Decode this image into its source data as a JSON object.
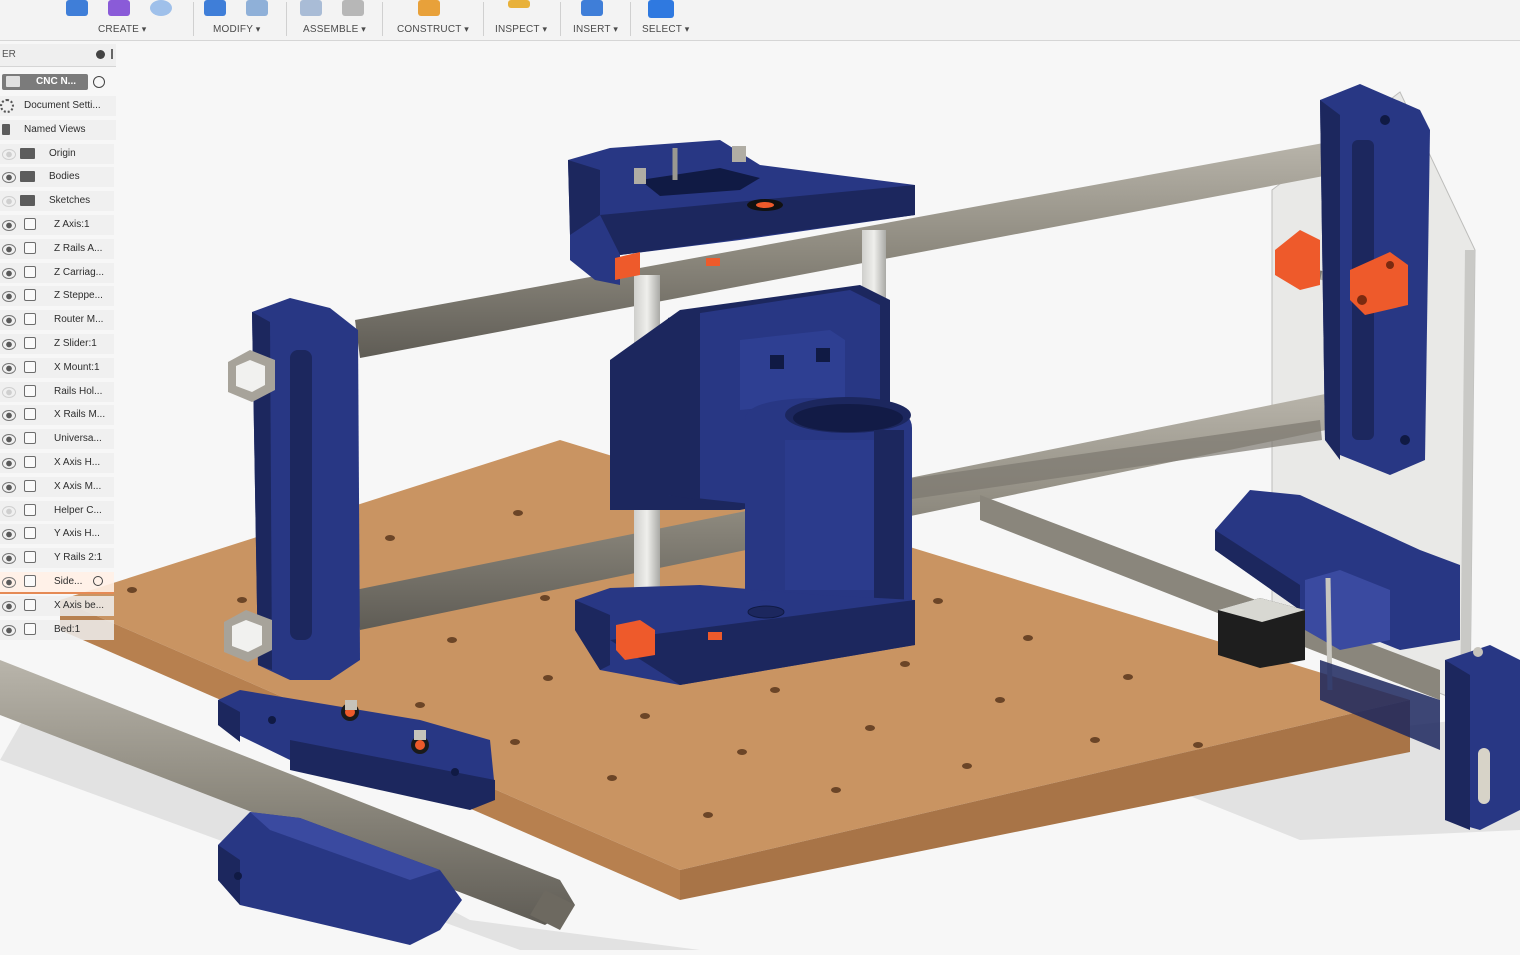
{
  "toolbar": {
    "groups": [
      {
        "label": "CREATE"
      },
      {
        "label": "MODIFY"
      },
      {
        "label": "ASSEMBLE"
      },
      {
        "label": "CONSTRUCT"
      },
      {
        "label": "INSPECT"
      },
      {
        "label": "INSERT"
      },
      {
        "label": "SELECT"
      }
    ]
  },
  "browser": {
    "header": "ER",
    "root": "CNC N...",
    "items": [
      {
        "label": "Document Setti...",
        "kind": "gear"
      },
      {
        "label": "Named Views",
        "kind": "folder-plain"
      },
      {
        "label": "Origin",
        "kind": "folder"
      },
      {
        "label": "Bodies",
        "kind": "folder"
      },
      {
        "label": "Sketches",
        "kind": "folder"
      },
      {
        "label": "Z Axis:1",
        "kind": "component"
      },
      {
        "label": "Z Rails A...",
        "kind": "component"
      },
      {
        "label": "Z Carriag...",
        "kind": "component"
      },
      {
        "label": "Z Steppe...",
        "kind": "component"
      },
      {
        "label": "Router M...",
        "kind": "component"
      },
      {
        "label": "Z Slider:1",
        "kind": "component"
      },
      {
        "label": "X Mount:1",
        "kind": "component"
      },
      {
        "label": "Rails Hol...",
        "kind": "component"
      },
      {
        "label": "X Rails M...",
        "kind": "component"
      },
      {
        "label": "Universa...",
        "kind": "component"
      },
      {
        "label": "X Axis H...",
        "kind": "component"
      },
      {
        "label": "X Axis M...",
        "kind": "component"
      },
      {
        "label": "Helper C...",
        "kind": "component"
      },
      {
        "label": "Y Axis H...",
        "kind": "component"
      },
      {
        "label": "Y Rails 2:1",
        "kind": "component"
      },
      {
        "label": "Side...",
        "kind": "component"
      },
      {
        "label": "X Axis be...",
        "kind": "component"
      },
      {
        "label": "Bed:1",
        "kind": "component"
      }
    ]
  },
  "colors": {
    "part": "#283784",
    "part_dark": "#1c275e",
    "part_light": "#3a4aa0",
    "rail": "#8e8a7f",
    "bed": "#c99462",
    "bed_edge": "#a87447",
    "accent": "#ee5a2b",
    "plate": "#e6e6e4"
  },
  "icons": [
    "eye-icon",
    "component-icon",
    "folder-icon",
    "gear-icon",
    "radio-icon"
  ]
}
